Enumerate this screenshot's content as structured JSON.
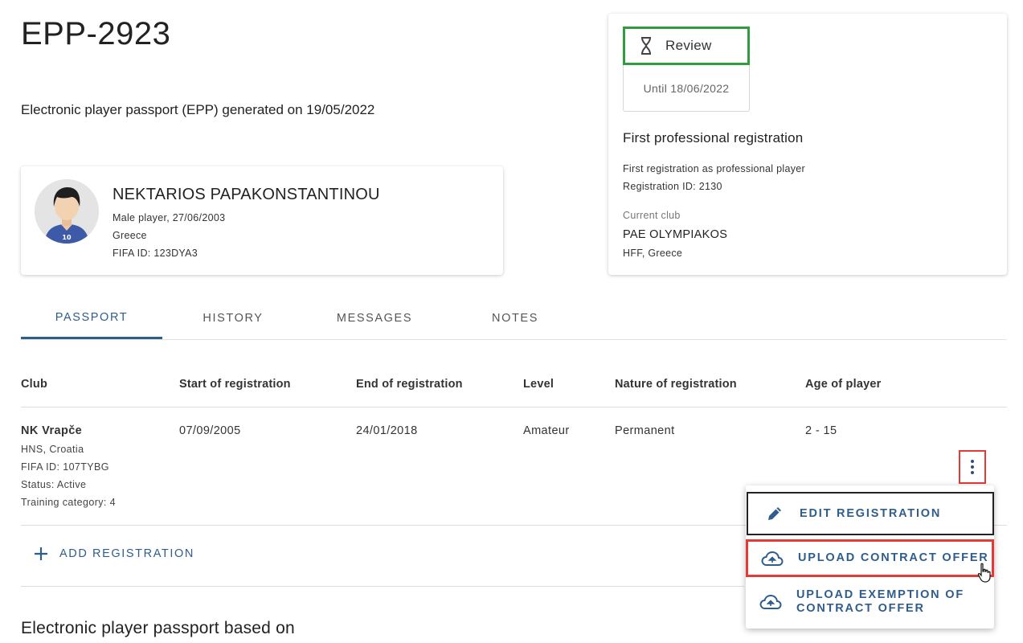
{
  "header": {
    "title": "EPP-2923",
    "subtitle": "Electronic player passport (EPP) generated on 19/05/2022"
  },
  "player": {
    "name": "NEKTARIOS PAPAKONSTANTINOU",
    "gender_dob": "Male player, 27/06/2003",
    "country": "Greece",
    "fifa_id": "FIFA ID: 123DYA3",
    "shirt_number": "10"
  },
  "registration_summary": {
    "status": "Review",
    "until": "Until 18/06/2022",
    "type": "First professional registration",
    "description": "First registration as professional player",
    "registration_id": "Registration ID: 2130",
    "current_club_label": "Current club",
    "current_club": "PAE OLYMPIAKOS",
    "current_club_assoc": "HFF, Greece",
    "status_color": "#2e9c3f"
  },
  "tabs": [
    {
      "label": "PASSPORT",
      "active": true
    },
    {
      "label": "HISTORY",
      "active": false
    },
    {
      "label": "MESSAGES",
      "active": false
    },
    {
      "label": "NOTES",
      "active": false
    }
  ],
  "table": {
    "columns": [
      "Club",
      "Start of registration",
      "End of registration",
      "Level",
      "Nature of registration",
      "Age of player"
    ],
    "rows": [
      {
        "club": "NK Vrapče",
        "club_assoc": "HNS, Croatia",
        "club_fifa_id": "FIFA ID: 107TYBG",
        "club_status": "Status: Active",
        "training_category": "Training category: 4",
        "start": "07/09/2005",
        "end": "24/01/2018",
        "level": "Amateur",
        "nature": "Permanent",
        "age": "2 - 15"
      }
    ]
  },
  "add_registration_label": "ADD REGISTRATION",
  "section_title": "Electronic player passport based on",
  "context_menu": {
    "items": [
      {
        "label": "EDIT REGISTRATION",
        "icon": "pencil-icon"
      },
      {
        "label": "UPLOAD CONTRACT OFFER",
        "icon": "cloud-upload-icon"
      },
      {
        "label": "UPLOAD EXEMPTION OF CONTRACT OFFER",
        "icon": "cloud-upload-icon"
      }
    ]
  },
  "colors": {
    "accent": "#2f5d8c",
    "highlight_red": "#e53935",
    "highlight_green": "#2e9c3f"
  }
}
